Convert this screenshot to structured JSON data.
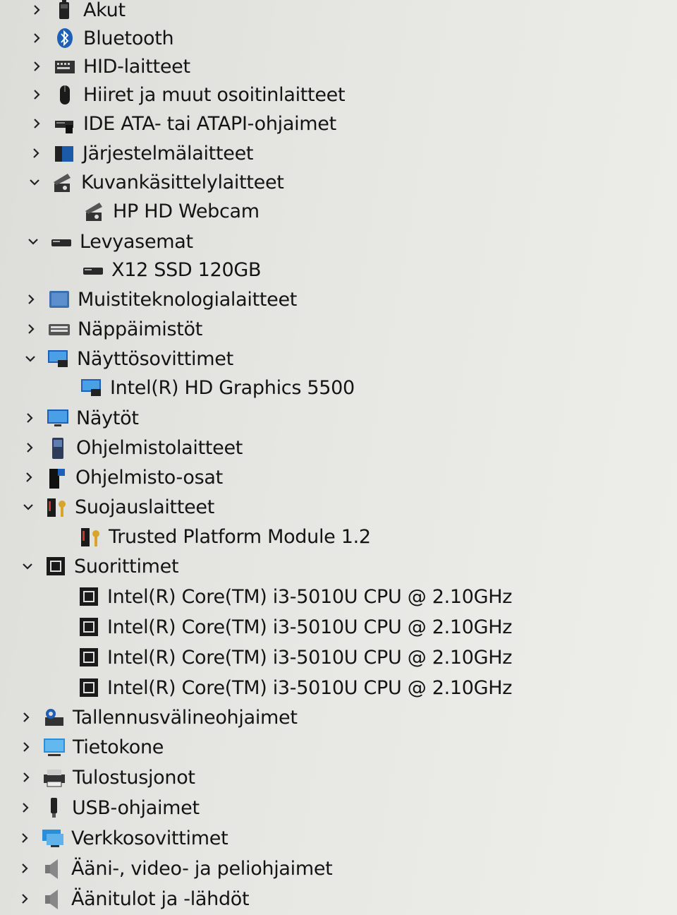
{
  "tree": {
    "nodes": [
      {
        "label": "Akut",
        "state": "collapsed",
        "icon": "battery-icon"
      },
      {
        "label": "Bluetooth",
        "state": "collapsed",
        "icon": "bluetooth-icon"
      },
      {
        "label": "HID-laitteet",
        "state": "collapsed",
        "icon": "hid-icon"
      },
      {
        "label": "Hiiret ja muut osoitinlaitteet",
        "state": "collapsed",
        "icon": "mouse-icon"
      },
      {
        "label": "IDE ATA- tai ATAPI-ohjaimet",
        "state": "collapsed",
        "icon": "ide-controller-icon"
      },
      {
        "label": "Järjestelmälaitteet",
        "state": "collapsed",
        "icon": "system-folder-icon"
      },
      {
        "label": "Kuvankäsittelylaitteet",
        "state": "expanded",
        "icon": "camera-icon"
      },
      {
        "label": "HP HD Webcam",
        "state": "child",
        "icon": "camera-icon"
      },
      {
        "label": "Levyasemat",
        "state": "expanded",
        "icon": "disk-drive-icon"
      },
      {
        "label": "X12 SSD 120GB",
        "state": "child",
        "icon": "disk-drive-icon"
      },
      {
        "label": "Muistiteknologialaitteet",
        "state": "collapsed",
        "icon": "memory-tech-icon"
      },
      {
        "label": "Näppäimistöt",
        "state": "collapsed",
        "icon": "keyboard-icon"
      },
      {
        "label": "Näyttösovittimet",
        "state": "expanded",
        "icon": "display-adapter-icon"
      },
      {
        "label": "Intel(R) HD Graphics 5500",
        "state": "child",
        "icon": "display-adapter-icon"
      },
      {
        "label": "Näytöt",
        "state": "collapsed",
        "icon": "monitor-icon"
      },
      {
        "label": "Ohjelmistolaitteet",
        "state": "collapsed",
        "icon": "software-device-icon"
      },
      {
        "label": "Ohjelmisto-osat",
        "state": "collapsed",
        "icon": "software-component-icon"
      },
      {
        "label": "Suojauslaitteet",
        "state": "expanded",
        "icon": "security-device-icon"
      },
      {
        "label": "Trusted Platform Module 1.2",
        "state": "child",
        "icon": "security-device-icon"
      },
      {
        "label": "Suorittimet",
        "state": "expanded",
        "icon": "processor-icon"
      },
      {
        "label": "Intel(R) Core(TM) i3-5010U CPU @ 2.10GHz",
        "state": "child",
        "icon": "processor-icon"
      },
      {
        "label": "Intel(R) Core(TM) i3-5010U CPU @ 2.10GHz",
        "state": "child",
        "icon": "processor-icon"
      },
      {
        "label": "Intel(R) Core(TM) i3-5010U CPU @ 2.10GHz",
        "state": "child",
        "icon": "processor-icon"
      },
      {
        "label": "Intel(R) Core(TM) i3-5010U CPU @ 2.10GHz",
        "state": "child",
        "icon": "processor-icon"
      },
      {
        "label": "Tallennusvälineohjaimet",
        "state": "collapsed",
        "icon": "storage-controller-icon"
      },
      {
        "label": "Tietokone",
        "state": "collapsed",
        "icon": "computer-icon"
      },
      {
        "label": "Tulostusjonot",
        "state": "collapsed",
        "icon": "printer-icon"
      },
      {
        "label": "USB-ohjaimet",
        "state": "collapsed",
        "icon": "usb-icon"
      },
      {
        "label": "Verkkosovittimet",
        "state": "collapsed",
        "icon": "network-adapter-icon"
      },
      {
        "label": "Ääni-, video- ja peliohjaimet",
        "state": "collapsed",
        "icon": "speaker-icon"
      },
      {
        "label": "Äänitulot ja -lähdöt",
        "state": "collapsed",
        "icon": "speaker-icon"
      }
    ]
  }
}
